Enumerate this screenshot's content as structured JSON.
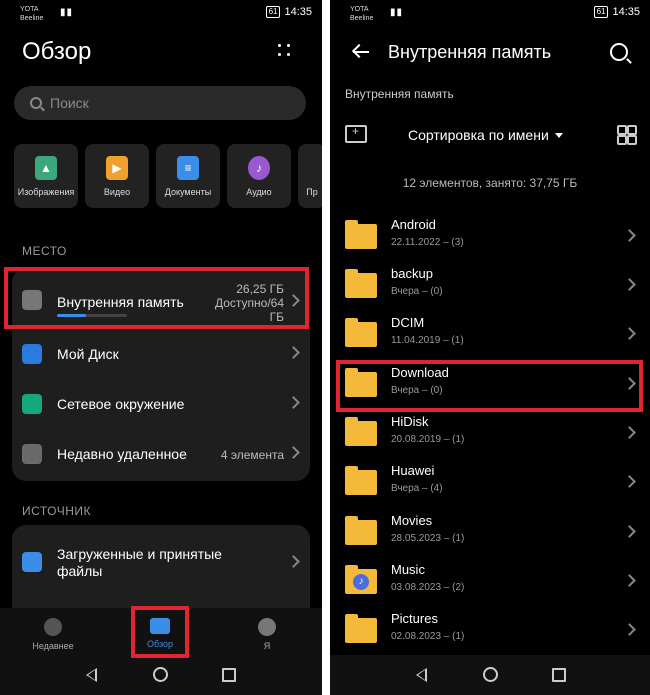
{
  "status": {
    "carrier1": "YOTA",
    "carrier2": "Beeline",
    "battery": "61",
    "time": "14:35"
  },
  "left": {
    "title": "Обзор",
    "search_placeholder": "Поиск",
    "categories": [
      {
        "label": "Изображения",
        "color": "#3aa87a",
        "icon": "image-icon"
      },
      {
        "label": "Видео",
        "color": "#f0a02c",
        "icon": "play-icon"
      },
      {
        "label": "Документы",
        "color": "#3b8ee8",
        "icon": "document-icon"
      },
      {
        "label": "Аудио",
        "color": "#9b59d0",
        "icon": "music-icon"
      },
      {
        "label": "Пр",
        "color": "#555555",
        "icon": "more-icon"
      }
    ],
    "section_location": "МЕСТО",
    "internal_storage": {
      "label": "Внутренняя память",
      "used": "26,25 ГБ",
      "avail_line1": "Доступно/64",
      "avail_line2": "ГБ",
      "progress": 0.41
    },
    "locations": [
      {
        "label": "Мой Диск",
        "meta": "",
        "color": "#2a7be0",
        "icon": "cloud-icon"
      },
      {
        "label": "Сетевое окружение",
        "meta": "",
        "color": "#17a77f",
        "icon": "network-icon"
      },
      {
        "label": "Недавно удаленное",
        "meta": "4 элемента",
        "color": "#6a6a6a",
        "icon": "trash-icon"
      }
    ],
    "section_source": "ИСТОЧНИК",
    "downloads_line1": "Загруженные и принятые",
    "downloads_line2": "файлы",
    "tabs": {
      "recent": "Недавнее",
      "browse": "Обзор",
      "me": "Я"
    }
  },
  "right": {
    "title": "Внутренняя память",
    "breadcrumb": "Внутренняя память",
    "sort_label": "Сортировка по имени",
    "summary": "12 элементов, занято: 37,75 ГБ",
    "folders": [
      {
        "name": "Android",
        "meta": "22.11.2022 – (3)"
      },
      {
        "name": "backup",
        "meta": "Вчера – (0)"
      },
      {
        "name": "DCIM",
        "meta": "11.04.2019 – (1)"
      },
      {
        "name": "Download",
        "meta": "Вчера – (0)"
      },
      {
        "name": "HiDisk",
        "meta": "20.08.2019 – (1)"
      },
      {
        "name": "Huawei",
        "meta": "Вчера – (4)"
      },
      {
        "name": "Movies",
        "meta": "28.05.2023 – (1)"
      },
      {
        "name": "Music",
        "meta": "03.08.2023 – (2)"
      },
      {
        "name": "Pictures",
        "meta": "02.08.2023 – (1)"
      }
    ]
  },
  "colors": {
    "highlight": "#e02530",
    "folder": "#f5b93a",
    "accent": "#3b8ee8"
  }
}
